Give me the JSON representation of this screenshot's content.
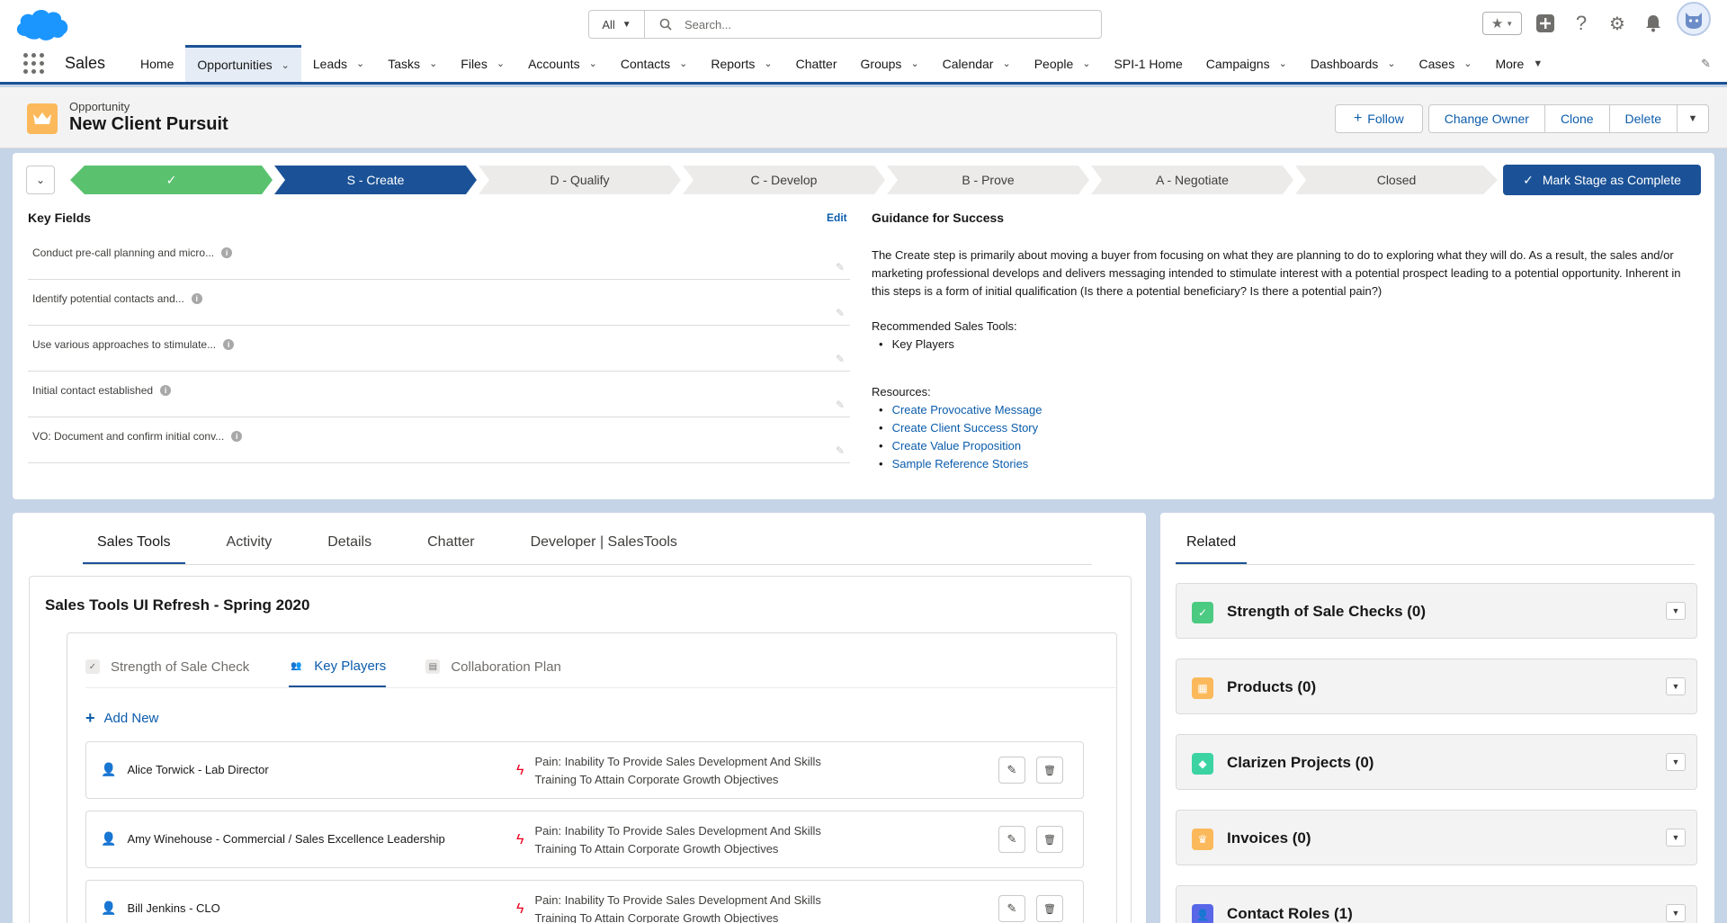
{
  "search": {
    "scope": "All",
    "placeholder": "Search..."
  },
  "nav": {
    "app_name": "Sales",
    "items": [
      {
        "label": "Home",
        "dropdown": false,
        "active": false
      },
      {
        "label": "Opportunities",
        "dropdown": true,
        "active": true
      },
      {
        "label": "Leads",
        "dropdown": true,
        "active": false
      },
      {
        "label": "Tasks",
        "dropdown": true,
        "active": false
      },
      {
        "label": "Files",
        "dropdown": true,
        "active": false
      },
      {
        "label": "Accounts",
        "dropdown": true,
        "active": false
      },
      {
        "label": "Contacts",
        "dropdown": true,
        "active": false
      },
      {
        "label": "Reports",
        "dropdown": true,
        "active": false
      },
      {
        "label": "Chatter",
        "dropdown": false,
        "active": false
      },
      {
        "label": "Groups",
        "dropdown": true,
        "active": false
      },
      {
        "label": "Calendar",
        "dropdown": true,
        "active": false
      },
      {
        "label": "People",
        "dropdown": true,
        "active": false
      },
      {
        "label": "SPI-1 Home",
        "dropdown": false,
        "active": false
      },
      {
        "label": "Campaigns",
        "dropdown": true,
        "active": false
      },
      {
        "label": "Dashboards",
        "dropdown": true,
        "active": false
      },
      {
        "label": "Cases",
        "dropdown": true,
        "active": false
      },
      {
        "label": "More",
        "dropdown": true,
        "active": false
      }
    ]
  },
  "record": {
    "type": "Opportunity",
    "title": "New Client Pursuit",
    "actions": {
      "follow": "Follow",
      "change_owner": "Change Owner",
      "clone": "Clone",
      "delete": "Delete"
    }
  },
  "path": {
    "stages": [
      {
        "label": "",
        "state": "complete"
      },
      {
        "label": "S - Create",
        "state": "current"
      },
      {
        "label": "D - Qualify",
        "state": "upcoming"
      },
      {
        "label": "C - Develop",
        "state": "upcoming"
      },
      {
        "label": "B - Prove",
        "state": "upcoming"
      },
      {
        "label": "A - Negotiate",
        "state": "upcoming"
      },
      {
        "label": "Closed",
        "state": "upcoming"
      }
    ],
    "mark_complete": "Mark Stage as Complete"
  },
  "key_fields": {
    "title": "Key Fields",
    "edit": "Edit",
    "fields": [
      "Conduct pre-call planning and micro...",
      "Identify potential contacts and...",
      "Use various approaches to stimulate...",
      "Initial contact established",
      "VO: Document and confirm initial conv..."
    ]
  },
  "guidance": {
    "title": "Guidance for Success",
    "body": "The Create step is primarily about moving a buyer from focusing on what they are planning to do to exploring what they will do. As a result, the sales and/or marketing professional develops and delivers messaging intended to stimulate interest with a potential prospect leading to a potential opportunity. Inherent in this steps is a form of initial qualification (Is there a potential beneficiary? Is there a potential pain?)",
    "tools_label": "Recommended Sales Tools:",
    "tools": [
      "Key Players"
    ],
    "resources_label": "Resources:",
    "resources": [
      "Create Provocative Message",
      "Create Client Success Story",
      "Create Value Proposition",
      "Sample Reference Stories"
    ]
  },
  "main_tabs": [
    "Sales Tools",
    "Activity",
    "Details",
    "Chatter",
    "Developer | SalesTools"
  ],
  "sales_tools": {
    "title": "Sales Tools UI Refresh - Spring 2020",
    "sub_tabs": [
      "Strength of Sale Check",
      "Key Players",
      "Collaboration Plan"
    ],
    "add_new": "Add New",
    "players": [
      {
        "name": "Alice Torwick - Lab Director",
        "pain1": "Pain: Inability To Provide Sales Development And Skills",
        "pain2": "Training To Attain Corporate Growth Objectives"
      },
      {
        "name": "Amy Winehouse - Commercial / Sales Excellence Leadership",
        "pain1": "Pain: Inability To Provide Sales Development And Skills",
        "pain2": "Training To Attain Corporate Growth Objectives"
      },
      {
        "name": "Bill Jenkins - CLO",
        "pain1": "Pain: Inability To Provide Sales Development And Skills",
        "pain2": "Training To Attain Corporate Growth Objectives"
      }
    ]
  },
  "related": {
    "tab": "Related",
    "items": [
      {
        "label": "Strength of Sale Checks (0)",
        "color": "#4bca81"
      },
      {
        "label": "Products (0)",
        "color": "#fcb95b"
      },
      {
        "label": "Clarizen Projects (0)",
        "color": "#3bd3a1"
      },
      {
        "label": "Invoices (0)",
        "color": "#fcb95b"
      },
      {
        "label": "Contact Roles (1)",
        "color": "#5867e8"
      }
    ]
  }
}
